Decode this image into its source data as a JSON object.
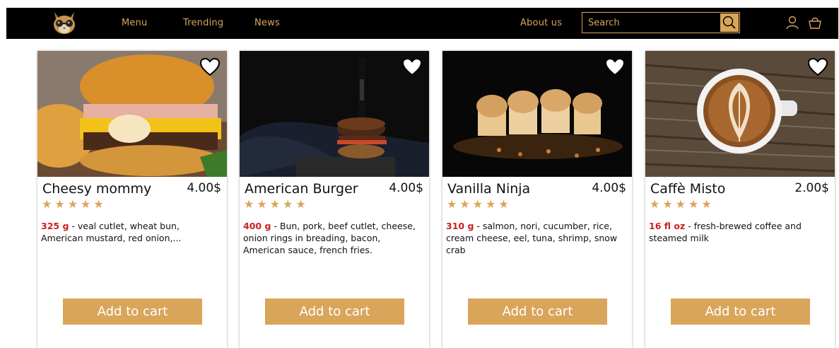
{
  "nav": {
    "links": [
      "Menu",
      "Trending",
      "News"
    ],
    "about": "About us",
    "search_placeholder": "Search"
  },
  "products": [
    {
      "name": "Cheesy mommy",
      "price": "4.00$",
      "stars": "★★★★★",
      "weight": "325 g",
      "desc": " - veal cutlet, wheat bun, American mustard, red onion,...",
      "button": "Add to cart"
    },
    {
      "name": "American Burger",
      "price": "4.00$",
      "stars": "★★★★★",
      "weight": "400 g",
      "desc": " - Bun, pork, beef cutlet, cheese, onion rings in breading, bacon, American sauce, french fries.",
      "button": "Add to cart"
    },
    {
      "name": "Vanilla Ninja",
      "price": "4.00$",
      "stars": "★★★★★",
      "weight": "310 g",
      "desc": " - salmon, nori, cucumber, rice, cream cheese, eel, tuna, shrimp, snow crab",
      "button": "Add to cart"
    },
    {
      "name": "Caffè Misto",
      "price": "2.00$",
      "stars": "★★★★★",
      "weight": "16 fl oz",
      "desc": " - fresh-brewed coffee and steamed milk",
      "button": "Add to cart"
    }
  ],
  "colors": {
    "accent": "#d9a55a",
    "weight": "#cc1f1f",
    "navbar": "#000000"
  },
  "icons": [
    "cat-logo-icon",
    "search-icon",
    "user-icon",
    "basket-icon",
    "heart-icon"
  ]
}
